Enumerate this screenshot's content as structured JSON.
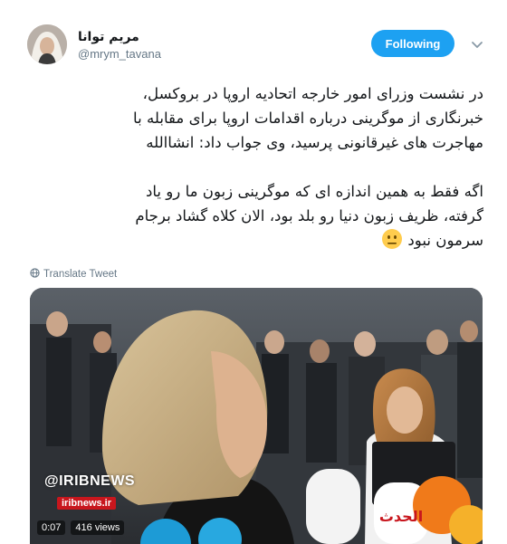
{
  "user": {
    "display_name": "مریم توانا",
    "handle": "@mrym_tavana"
  },
  "follow_button": {
    "label": "Following"
  },
  "tweet": {
    "paragraph1": [
      "در نشست وزرای امور خارجه اتحادیه اروپا در بروکسل،",
      "خبرنگاری از موگرینی درباره اقدامات اروپا برای مقابله با",
      "مهاجرت های غیرقانونی پرسید، وی جواب داد: انشاالله"
    ],
    "paragraph2": [
      "اگه فقط به همین اندازه ای که موگرینی زبون ما رو یاد",
      "گرفته، ظریف زبون دنیا رو بلد بود، الان کلاه گشاد برجام",
      "سرمون نبود"
    ],
    "emoji": "neutral-face-emoji"
  },
  "translate": {
    "label": "Translate Tweet",
    "icon": "globe-icon"
  },
  "video": {
    "watermark": "@IRIBNEWS",
    "url_badge": "iribnews.ir",
    "mic_text": "الحدث",
    "time": "0:07",
    "views": "416 views"
  },
  "colors": {
    "accent": "#1da1f2",
    "text": "#14171a",
    "secondary": "#657786",
    "brand_red": "#c8161d"
  }
}
